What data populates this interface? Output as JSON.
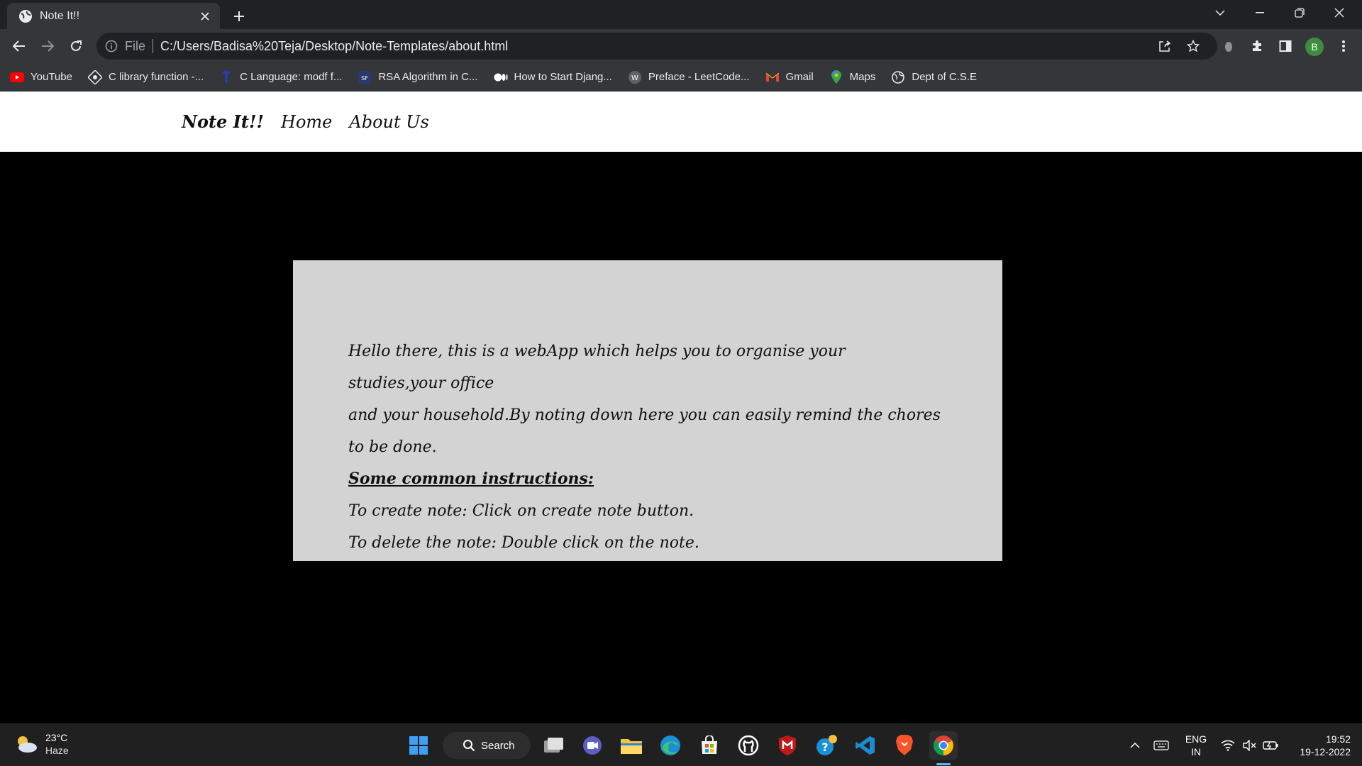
{
  "browser": {
    "tab": {
      "title": "Note It!!"
    },
    "address": {
      "scheme_label": "File",
      "url": "C:/Users/Badisa%20Teja/Desktop/Note-Templates/about.html"
    },
    "profile_initial": "B",
    "bookmarks": [
      {
        "label": "YouTube",
        "icon": "youtube-icon"
      },
      {
        "label": "C library function -...",
        "icon": "tutorials-icon"
      },
      {
        "label": "C Language: modf f...",
        "icon": "techonthenet-icon"
      },
      {
        "label": "RSA Algorithm in C...",
        "icon": "geeks-icon"
      },
      {
        "label": "How to Start Djang...",
        "icon": "medium-icon"
      },
      {
        "label": "Preface - LeetCode...",
        "icon": "w-icon"
      },
      {
        "label": "Gmail",
        "icon": "gmail-icon"
      },
      {
        "label": "Maps",
        "icon": "maps-icon"
      },
      {
        "label": "Dept of C.S.E",
        "icon": "globe-icon"
      }
    ]
  },
  "site": {
    "nav": {
      "brand": "Note It!!",
      "home": "Home",
      "about": "About Us"
    },
    "about": {
      "line1": "Hello there, this is a webApp which helps you to organise your studies,your office",
      "line2": "and your household.By noting down here you can easily remind the chores to be done.",
      "heading": "Some common instructions:",
      "instruction1": "To create note: Click on create note button.",
      "instruction2": "To delete the note: Double click on the note."
    }
  },
  "taskbar": {
    "weather": {
      "temp": "23°C",
      "condition": "Haze"
    },
    "search_label": "Search",
    "language": {
      "line1": "ENG",
      "line2": "IN"
    },
    "clock": {
      "time": "19:52",
      "date": "19-12-2022"
    }
  },
  "colors": {
    "page_bg": "#000000",
    "card_bg": "#d3d3d3",
    "nav_bg": "#ffffff",
    "chrome_dark": "#202124",
    "chrome_toolbar": "#35363a"
  }
}
